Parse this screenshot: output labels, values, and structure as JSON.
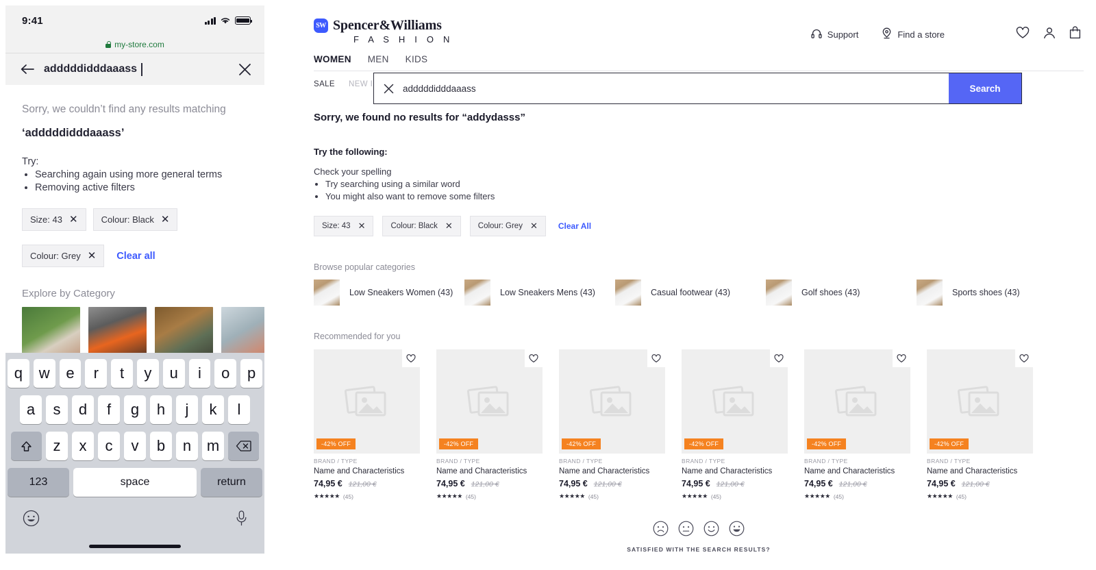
{
  "mobile": {
    "status": {
      "time": "9:41"
    },
    "browser": {
      "url": "my-store.com",
      "lock_icon": "lock-icon"
    },
    "search": {
      "query": "adddddidddaaass",
      "back_icon": "back-arrow-icon",
      "close_icon": "close-icon"
    },
    "empty": {
      "sorry": "Sorry, we couldn’t find any results matching",
      "term": "‘adddddidddaaass’",
      "try_label": "Try:",
      "tips": [
        "Searching again using more general terms",
        "Removing active filters"
      ]
    },
    "filters": {
      "chips": [
        {
          "label": "Size: 43",
          "remove_icon": "close-icon"
        },
        {
          "label": "Colour: Black",
          "remove_icon": "close-icon"
        },
        {
          "label": "Colour: Grey",
          "remove_icon": "close-icon"
        }
      ],
      "clear_all": "Clear all"
    },
    "explore": {
      "title": "Explore by Category",
      "tiles": [
        "tennis-court-photo",
        "orange-sneaker-photo",
        "woman-athleisure-photo",
        "runner-track-photo"
      ]
    },
    "keyboard": {
      "row1": [
        "q",
        "w",
        "e",
        "r",
        "t",
        "y",
        "u",
        "i",
        "o",
        "p"
      ],
      "row2": [
        "a",
        "s",
        "d",
        "f",
        "g",
        "h",
        "j",
        "k",
        "l"
      ],
      "row3": [
        "z",
        "x",
        "c",
        "v",
        "b",
        "n",
        "m"
      ],
      "shift_icon": "shift-up-icon",
      "backspace_icon": "backspace-icon",
      "numbers_key": "123",
      "space_key": "space",
      "return_key": "return",
      "emoji_icon": "emoji-smiley-icon",
      "mic_icon": "microphone-icon"
    }
  },
  "desktop": {
    "brand": {
      "mark": "SW",
      "name": "Spencer&Williams",
      "tagline": "F A S H I O N"
    },
    "utility": [
      {
        "label": "Support",
        "icon": "headset-icon"
      },
      {
        "label": "Find a store",
        "icon": "location-pin-icon"
      }
    ],
    "account_icons": [
      {
        "icon": "heart-icon",
        "name": "wishlist-icon"
      },
      {
        "icon": "person-icon",
        "name": "account-icon"
      },
      {
        "icon": "bag-icon",
        "name": "cart-icon"
      }
    ],
    "nav_main": [
      {
        "label": "WOMEN",
        "active": true
      },
      {
        "label": "MEN",
        "active": false
      },
      {
        "label": "KIDS",
        "active": false
      }
    ],
    "nav_sub": [
      {
        "label": "SALE"
      },
      {
        "label": "NEW IN"
      }
    ],
    "search": {
      "value": "adddddidddaaass",
      "clear_icon": "close-icon",
      "button_label": "Search",
      "button_color": "#5566f5"
    },
    "results": {
      "no_results": "Sorry, we found no results for “addydasss”",
      "try_heading": "Try the following:",
      "spelling": "Check your spelling",
      "tips": [
        "Try searching using a similar word",
        "You might also want to remove some filters"
      ]
    },
    "filters": {
      "chips": [
        {
          "label": "Size: 43",
          "remove_icon": "close-icon"
        },
        {
          "label": "Colour: Black",
          "remove_icon": "close-icon"
        },
        {
          "label": "Colour: Grey",
          "remove_icon": "close-icon"
        }
      ],
      "clear_all": "Clear All"
    },
    "categories": {
      "title": "Browse popular categories",
      "items": [
        {
          "label": "Low Sneakers Women (43)"
        },
        {
          "label": "Low Sneakers Mens (43)"
        },
        {
          "label": "Casual footwear (43)"
        },
        {
          "label": "Golf shoes (43)"
        },
        {
          "label": "Sports shoes (43)"
        }
      ]
    },
    "recommended": {
      "title": "Recommended for you",
      "products": [
        {
          "badge": "-42% OFF",
          "brand": "BRAND / TYPE",
          "name": "Name and Characteristics",
          "price": "74,95 €",
          "old_price": "121,00 €",
          "stars": "★★★★★",
          "reviews": "(45)",
          "fav_icon": "heart-icon"
        },
        {
          "badge": "-42% OFF",
          "brand": "BRAND / TYPE",
          "name": "Name and Characteristics",
          "price": "74,95 €",
          "old_price": "121,00 €",
          "stars": "★★★★★",
          "reviews": "(45)",
          "fav_icon": "heart-icon"
        },
        {
          "badge": "-42% OFF",
          "brand": "BRAND / TYPE",
          "name": "Name and Characteristics",
          "price": "74,95 €",
          "old_price": "121,00 €",
          "stars": "★★★★★",
          "reviews": "(45)",
          "fav_icon": "heart-icon"
        },
        {
          "badge": "-42% OFF",
          "brand": "BRAND / TYPE",
          "name": "Name and Characteristics",
          "price": "74,95 €",
          "old_price": "121,00 €",
          "stars": "★★★★★",
          "reviews": "(45)",
          "fav_icon": "heart-icon"
        },
        {
          "badge": "-42% OFF",
          "brand": "BRAND / TYPE",
          "name": "Name and Characteristics",
          "price": "74,95 €",
          "old_price": "121,00 €",
          "stars": "★★★★★",
          "reviews": "(45)",
          "fav_icon": "heart-icon"
        },
        {
          "badge": "-42% OFF",
          "brand": "BRAND / TYPE",
          "name": "Name and Characteristics",
          "price": "74,95 €",
          "old_price": "121,00 €",
          "stars": "★★★★★",
          "reviews": "(45)",
          "fav_icon": "heart-icon"
        }
      ]
    },
    "feedback": {
      "question": "SATISFIED WITH THE SEARCH RESULTS?",
      "faces": [
        "face-sad-icon",
        "face-neutral-icon",
        "face-smile-icon",
        "face-grin-icon"
      ]
    }
  }
}
